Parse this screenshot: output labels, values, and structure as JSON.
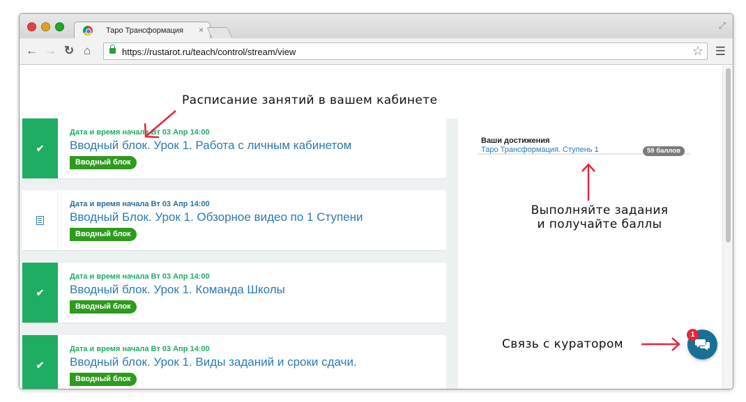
{
  "browser": {
    "tab_title": "Таро Трансформация",
    "tab_close": "×",
    "url": "https://rustarot.ru/teach/control/stream/view"
  },
  "lessons": [
    {
      "date": "Дата и время начала Вт 03 Апр 14:00",
      "title": "Вводный блок. Урок 1. Работа с личным кабинетом",
      "tag": "Вводный блок",
      "status": "completed"
    },
    {
      "date": "Дата и время начала Вт 03 Апр 14:00",
      "title": "Вводный Блок. Урок 1. Обзорное видео по 1 Ступени",
      "tag": "Вводный блок",
      "status": "pending"
    },
    {
      "date": "Дата и время начала Вт 03 Апр 14:00",
      "title": "Вводный блок. Урок 1. Команда Школы",
      "tag": "Вводный блок",
      "status": "completed"
    },
    {
      "date": "Дата и время начала Вт 03 Апр 14:00",
      "title": "Вводный блок. Урок 1. Виды заданий и сроки сдачи.",
      "tag": "Вводный блок",
      "status": "completed"
    }
  ],
  "achievements": {
    "header": "Ваши достижения",
    "item_label": "Таро Трансформация. Ступень 1",
    "points": "59 баллов"
  },
  "annotations": {
    "schedule": "Расписание занятий в вашем кабинете",
    "tasks_line1": "Выполняйте задания",
    "tasks_line2": "и получайте баллы",
    "curator": "Связь с куратором"
  },
  "chat": {
    "badge_count": "1"
  },
  "colors": {
    "completed_green": "#1fad63",
    "tag_green": "#2f9a1e",
    "link_blue": "#2a7ab8",
    "arrow_red": "#e8253d",
    "chat_blue": "#1b6f95"
  }
}
